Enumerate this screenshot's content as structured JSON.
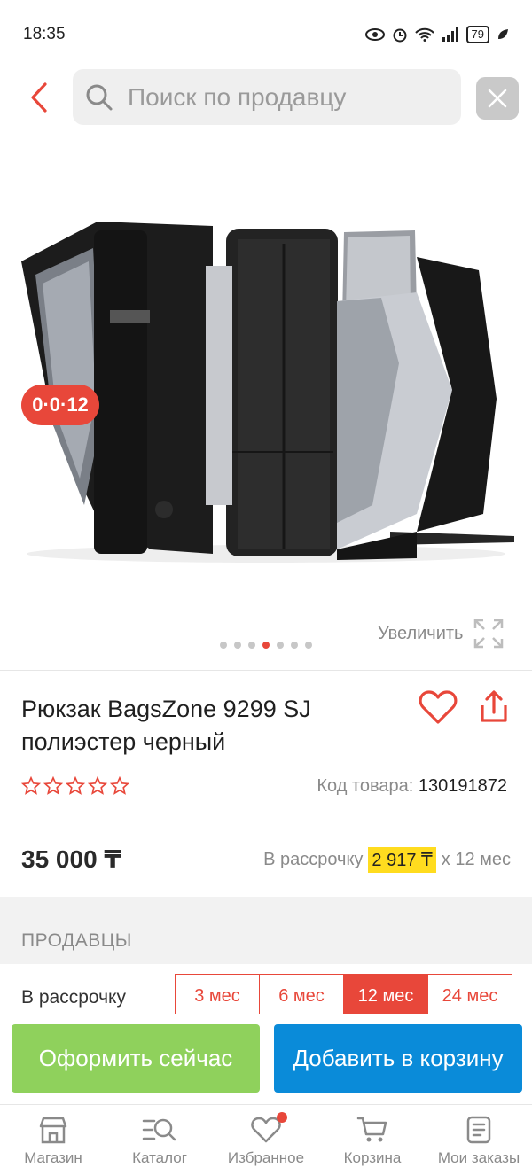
{
  "status_bar": {
    "time": "18:35",
    "battery": "79"
  },
  "search": {
    "placeholder": "Поиск по продавцу"
  },
  "gallery": {
    "timer_badge": "0·0·12",
    "zoom_label": "Увеличить",
    "dot_count": 7,
    "active_dot": 3
  },
  "product": {
    "title": "Рюкзак BagsZone 9299 SJ полиэстер черный",
    "sku_label": "Код товара:",
    "sku_value": "130191872",
    "rating_stars": 0,
    "price": "35 000 ₸",
    "installment_label": "В рассрочку",
    "installment_amount": "2 917 ₸",
    "installment_term": "х 12 мес"
  },
  "sellers": {
    "heading": "ПРОДАВЦЫ",
    "installment_label": "В рассрочку",
    "terms": [
      "3 мес",
      "6 мес",
      "12 мес",
      "24 мес"
    ],
    "active_term": "12 мес"
  },
  "actions": {
    "buy_now": "Оформить сейчас",
    "add_to_cart": "Добавить в корзину"
  },
  "bottom_nav": [
    {
      "label": "Магазин",
      "icon": "store-icon"
    },
    {
      "label": "Каталог",
      "icon": "catalog-search-icon"
    },
    {
      "label": "Избранное",
      "icon": "heart-icon"
    },
    {
      "label": "Корзина",
      "icon": "cart-icon"
    },
    {
      "label": "Мои заказы",
      "icon": "orders-icon"
    }
  ],
  "colors": {
    "accent_red": "#e8473a",
    "buy_green": "#8fd15c",
    "cart_blue": "#0a8bd9",
    "installment_yellow": "#ffdc1f"
  }
}
